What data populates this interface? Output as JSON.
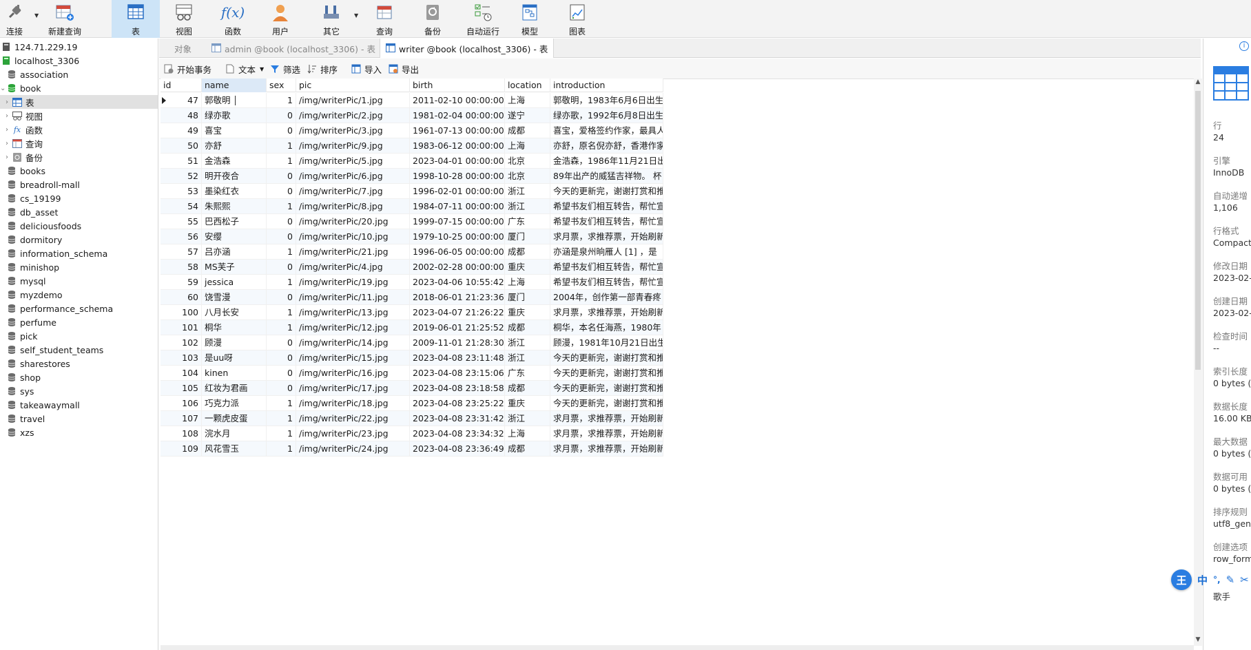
{
  "toolbar": {
    "connect": "连接",
    "new_query": "新建查询",
    "table": "表",
    "view": "视图",
    "function": "函数",
    "user": "用户",
    "other": "其它",
    "query": "查询",
    "backup": "备份",
    "auto_run": "自动运行",
    "model": "模型",
    "chart": "图表"
  },
  "sidebar": {
    "items": [
      {
        "label": "124.71.229.19"
      },
      {
        "label": "localhost_3306"
      },
      {
        "label": "association"
      },
      {
        "label": "book"
      },
      {
        "label": "表"
      },
      {
        "label": "视图"
      },
      {
        "label": "函数"
      },
      {
        "label": "查询"
      },
      {
        "label": "备份"
      },
      {
        "label": "books"
      },
      {
        "label": "breadroll-mall"
      },
      {
        "label": "cs_19199"
      },
      {
        "label": "db_asset"
      },
      {
        "label": "deliciousfoods"
      },
      {
        "label": "dormitory"
      },
      {
        "label": "information_schema"
      },
      {
        "label": "minishop"
      },
      {
        "label": "mysql"
      },
      {
        "label": "myzdemo"
      },
      {
        "label": "performance_schema"
      },
      {
        "label": "perfume"
      },
      {
        "label": "pick"
      },
      {
        "label": "self_student_teams"
      },
      {
        "label": "sharestores"
      },
      {
        "label": "shop"
      },
      {
        "label": "sys"
      },
      {
        "label": "takeawaymall"
      },
      {
        "label": "travel"
      },
      {
        "label": "xzs"
      }
    ]
  },
  "tabs": {
    "objects": "对象",
    "tab1": "admin @book (localhost_3306) - 表",
    "tab2": "writer @book (localhost_3306) - 表"
  },
  "subbar": {
    "begin_tx": "开始事务",
    "text": "文本",
    "filter": "筛选",
    "sort": "排序",
    "import": "导入",
    "export": "导出"
  },
  "grid": {
    "columns": [
      "id",
      "name",
      "sex",
      "pic",
      "birth",
      "location",
      "introduction"
    ],
    "rows": [
      [
        "47",
        "郭敬明",
        "1",
        "/img/writerPic/1.jpg",
        "2011-02-10 00:00:00",
        "上海",
        "郭敬明，1983年6月6日出生"
      ],
      [
        "48",
        "绿亦歌",
        "0",
        "/img/writerPic/2.jpg",
        "1981-02-04 00:00:00",
        "遂宁",
        "绿亦歌，1992年6月8日出生"
      ],
      [
        "49",
        "喜宝",
        "0",
        "/img/writerPic/3.jpg",
        "1961-07-13 00:00:00",
        "成都",
        "喜宝，爱格签约作家，最具人"
      ],
      [
        "50",
        "亦舒",
        "1",
        "/img/writerPic/9.jpg",
        "1983-06-12 00:00:00",
        "上海",
        "亦舒，原名倪亦舒，香港作家"
      ],
      [
        "51",
        "金浩森",
        "1",
        "/img/writerPic/5.jpg",
        "2023-04-01 00:00:00",
        "北京",
        "金浩森，1986年11月21日出"
      ],
      [
        "52",
        "明开夜合",
        "0",
        "/img/writerPic/6.jpg",
        "1998-10-28 00:00:00",
        "北京",
        "89年出产的威猛吉祥物。 杯"
      ],
      [
        "53",
        "墨染红衣",
        "0",
        "/img/writerPic/7.jpg",
        "1996-02-01 00:00:00",
        "浙江",
        "今天的更新完，谢谢打赏和推"
      ],
      [
        "54",
        "朱熙熙",
        "1",
        "/img/writerPic/8.jpg",
        "1984-07-11 00:00:00",
        "浙江",
        "希望书友们相互转告，帮忙宣"
      ],
      [
        "55",
        "巴西松子",
        "0",
        "/img/writerPic/20.jpg",
        "1999-07-15 00:00:00",
        "广东",
        "希望书友们相互转告，帮忙宣"
      ],
      [
        "56",
        "安缨",
        "0",
        "/img/writerPic/10.jpg",
        "1979-10-25 00:00:00",
        "厦门",
        "求月票，求推荐票，开始刷新"
      ],
      [
        "57",
        "吕亦涵",
        "1",
        "/img/writerPic/21.jpg",
        "1996-06-05 00:00:00",
        "成都",
        "亦涵是泉州晌雁人 [1] ，是"
      ],
      [
        "58",
        "MS芙子",
        "0",
        "/img/writerPic/4.jpg",
        "2002-02-28 00:00:00",
        "重庆",
        "希望书友们相互转告，帮忙宣"
      ],
      [
        "59",
        "jessica",
        "1",
        "/img/writerPic/19.jpg",
        "2023-04-06 10:55:42",
        "上海",
        "希望书友们相互转告，帮忙宣"
      ],
      [
        "60",
        "饶雪漫",
        "0",
        "/img/writerPic/11.jpg",
        "2018-06-01 21:23:36",
        "厦门",
        "2004年，创作第一部青春疼"
      ],
      [
        "100",
        "八月长安",
        "1",
        "/img/writerPic/13.jpg",
        "2023-04-07 21:26:22",
        "重庆",
        "求月票，求推荐票，开始刷新"
      ],
      [
        "101",
        "桐华",
        "1",
        "/img/writerPic/12.jpg",
        "2019-06-01 21:25:52",
        "成都",
        "桐华，本名任海燕，1980年"
      ],
      [
        "102",
        "顾漫",
        "0",
        "/img/writerPic/14.jpg",
        "2009-11-01 21:28:30",
        "浙江",
        "顾漫，1981年10月21日出生"
      ],
      [
        "103",
        "是uu呀",
        "0",
        "/img/writerPic/15.jpg",
        "2023-04-08 23:11:48",
        "浙江",
        "今天的更新完，谢谢打赏和推"
      ],
      [
        "104",
        "kinen",
        "0",
        "/img/writerPic/16.jpg",
        "2023-04-08 23:15:06",
        "广东",
        "今天的更新完，谢谢打赏和推"
      ],
      [
        "105",
        "红妆为君画",
        "0",
        "/img/writerPic/17.jpg",
        "2023-04-08 23:18:58",
        "成都",
        "今天的更新完，谢谢打赏和推"
      ],
      [
        "106",
        "巧克力派",
        "1",
        "/img/writerPic/18.jpg",
        "2023-04-08 23:25:22",
        "重庆",
        "今天的更新完，谢谢打赏和推"
      ],
      [
        "107",
        "一颗虎皮蛋",
        "1",
        "/img/writerPic/22.jpg",
        "2023-04-08 23:31:42",
        "浙江",
        "求月票，求推荐票，开始刷新"
      ],
      [
        "108",
        "浣水月",
        "1",
        "/img/writerPic/23.jpg",
        "2023-04-08 23:34:32",
        "上海",
        "求月票，求推荐票，开始刷新"
      ],
      [
        "109",
        "风花雪玉",
        "1",
        "/img/writerPic/24.jpg",
        "2023-04-08 23:36:49",
        "成都",
        "求月票，求推荐票，开始刷新"
      ]
    ]
  },
  "info": {
    "rows_label": "行",
    "rows_value": "24",
    "engine_label": "引擎",
    "engine_value": "InnoDB",
    "auto_inc_label": "自动递增",
    "auto_inc_value": "1,106",
    "row_format_label": "行格式",
    "row_format_value": "Compact",
    "modified_label": "修改日期",
    "modified_value": "2023-02-",
    "created_label": "创建日期",
    "created_value": "2023-02-",
    "check_time_label": "检查时间",
    "check_time_value": "--",
    "index_len_label": "索引长度",
    "index_len_value": "0 bytes (",
    "data_len_label": "数据长度",
    "data_len_value": "16.00 KB",
    "max_data_label": "最大数据",
    "max_data_value": "0 bytes (",
    "data_free_label": "数据可用",
    "data_free_value": "0 bytes (",
    "collation_label": "排序规则",
    "collation_value": "utf8_gene",
    "create_opts_label": "创建选项",
    "create_opts_value": "row_form",
    "comment_value": "歌手"
  },
  "ime": {
    "logo": "王",
    "lang": "中",
    "punct": "°,"
  },
  "colors": {
    "toolbar_active": "#cde4f7",
    "db_icon": "#6b6b6b",
    "db_active_icon": "#2ca33a",
    "accent": "#2a7de1"
  }
}
